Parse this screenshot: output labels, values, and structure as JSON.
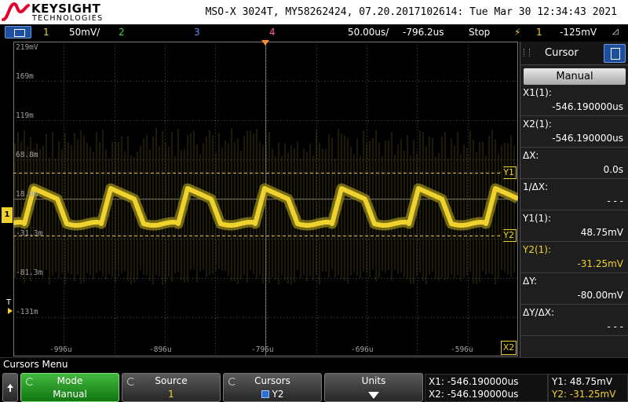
{
  "header": {
    "brand": "KEYSIGHT",
    "brand_sub": "TECHNOLOGIES",
    "title": "MSO-X 3024T, MY58262424, 07.20.2017102614: Tue Mar 30 12:34:43 2021"
  },
  "status": {
    "ch1_num": "1",
    "ch1_scale": "50mV/",
    "ch2_num": "2",
    "ch3_num": "3",
    "ch4_num": "4",
    "timebase": "50.00us/",
    "delay": "-796.2us",
    "run_state": "Stop",
    "trigger_ch": "1",
    "trigger_level": "-125mV",
    "colors": {
      "ch1": "#f0d22e",
      "ch2": "#46d246",
      "ch3": "#5a8cff",
      "ch4": "#ff5aa0"
    }
  },
  "display": {
    "y_labels": [
      "219mV",
      "169m",
      "119m",
      "68.8m",
      "18.8m",
      "-31.3m",
      "-81.3m",
      "-131m"
    ],
    "x_labels": [
      "-996u",
      "-896u",
      "-796u",
      "-696u",
      "-596u"
    ],
    "cursor_tags": {
      "y1": "Y1",
      "y2": "Y2",
      "x2": "X2"
    },
    "trigger_marker": "T",
    "ground_marker": "1"
  },
  "panel": {
    "title": "Cursor",
    "mode_label": "Manual",
    "rows": [
      {
        "key": "X1(1):",
        "value": "-546.190000us"
      },
      {
        "key": "X2(1):",
        "value": "-546.190000us"
      },
      {
        "key": "ΔX:",
        "value": "0.0s"
      },
      {
        "key": "1/ΔX:",
        "value": "- - -"
      },
      {
        "key": "Y1(1):",
        "value": "48.75mV"
      },
      {
        "key": "Y2(1):",
        "value": "-31.25mV"
      },
      {
        "key": "ΔY:",
        "value": "-80.00mV"
      },
      {
        "key": "ΔY/ΔX:",
        "value": "- - -"
      }
    ]
  },
  "softkeys": {
    "menu_name": "Cursors Menu",
    "mode": {
      "title": "Mode",
      "value": "Manual"
    },
    "source": {
      "title": "Source",
      "value": "1"
    },
    "cursors": {
      "title": "Cursors",
      "value": "Y2"
    },
    "units": {
      "title": "Units"
    },
    "readout": {
      "x1": "X1:  -546.190000us",
      "x2": "X2:  -546.190000us",
      "y1": "Y1: 48.75mV",
      "y2": "Y2: -31.25mV"
    }
  }
}
